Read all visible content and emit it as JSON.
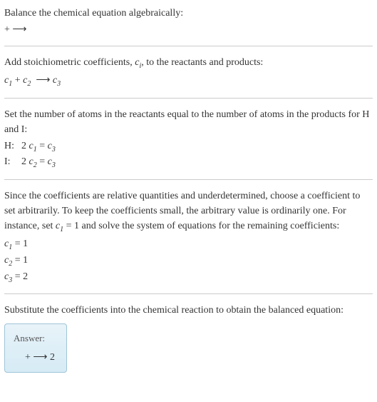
{
  "section1": {
    "line1": "Balance the chemical equation algebraically:",
    "line2_prefix": " + ",
    "arrow": "⟶"
  },
  "section2": {
    "line1_prefix": "Add stoichiometric coefficients, ",
    "line1_ci": "c",
    "line1_ci_sub": "i",
    "line1_suffix": ", to the reactants and products:",
    "eq_c1": "c",
    "eq_c1_sub": "1",
    "eq_plus": " + ",
    "eq_c2": "c",
    "eq_c2_sub": "2",
    "eq_arrow": "⟶",
    "eq_c3": "c",
    "eq_c3_sub": "3"
  },
  "section3": {
    "line1": "Set the number of atoms in the reactants equal to the number of atoms in the products for H and I:",
    "rows": [
      {
        "label": "H: ",
        "lhs_coef": "2 ",
        "lhs_c": "c",
        "lhs_sub": "1",
        "eq": " = ",
        "rhs_c": "c",
        "rhs_sub": "3"
      },
      {
        "label": " I: ",
        "lhs_coef": "2 ",
        "lhs_c": "c",
        "lhs_sub": "2",
        "eq": " = ",
        "rhs_c": "c",
        "rhs_sub": "3"
      }
    ]
  },
  "section4": {
    "line1_a": "Since the coefficients are relative quantities and underdetermined, choose a coefficient to set arbitrarily. To keep the coefficients small, the arbitrary value is ordinarily one. For instance, set ",
    "line1_c": "c",
    "line1_sub": "1",
    "line1_b": " = 1 and solve the system of equations for the remaining coefficients:",
    "coefs": [
      {
        "c": "c",
        "sub": "1",
        "val": " = 1"
      },
      {
        "c": "c",
        "sub": "2",
        "val": " = 1"
      },
      {
        "c": "c",
        "sub": "3",
        "val": " = 2"
      }
    ]
  },
  "section5": {
    "line1": "Substitute the coefficients into the chemical reaction to obtain the balanced equation:"
  },
  "answer": {
    "label": "Answer:",
    "prefix": " + ",
    "arrow": "⟶",
    "suffix": " 2"
  }
}
